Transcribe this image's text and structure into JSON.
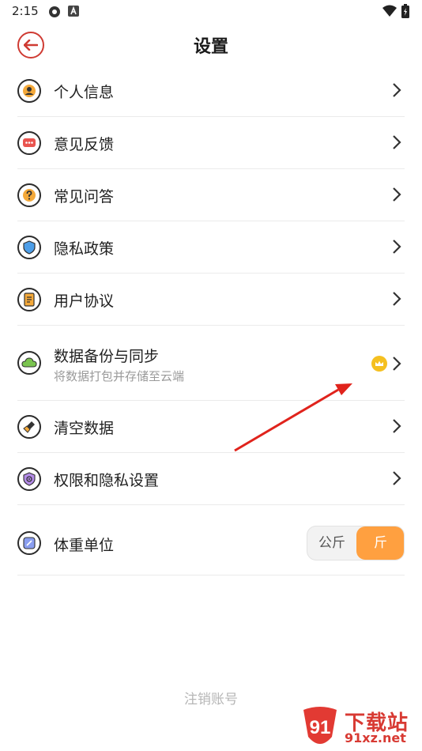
{
  "status_bar": {
    "time": "2:15"
  },
  "header": {
    "title": "设置",
    "back_icon": "back-arrow-icon",
    "accent": "#cf3b33"
  },
  "settings": [
    {
      "label": "个人信息",
      "icon": "person-icon"
    },
    {
      "label": "意见反馈",
      "icon": "feedback-icon"
    },
    {
      "label": "常见问答",
      "icon": "question-icon"
    },
    {
      "label": "隐私政策",
      "icon": "shield-icon"
    },
    {
      "label": "用户协议",
      "icon": "document-icon"
    },
    {
      "label": "数据备份与同步",
      "sublabel": "将数据打包并存储至云端",
      "icon": "cloud-icon",
      "badge": "crown-icon"
    },
    {
      "label": "清空数据",
      "icon": "broom-icon"
    },
    {
      "label": "权限和隐私设置",
      "icon": "permission-icon"
    }
  ],
  "weight_unit": {
    "label": "体重单位",
    "icon": "scale-icon",
    "options": [
      "公斤",
      "斤"
    ],
    "selected": "斤",
    "selected_color": "#ffa040"
  },
  "logout_label": "注销账号",
  "watermark": {
    "text": "下载站",
    "url": "91xz.net"
  }
}
